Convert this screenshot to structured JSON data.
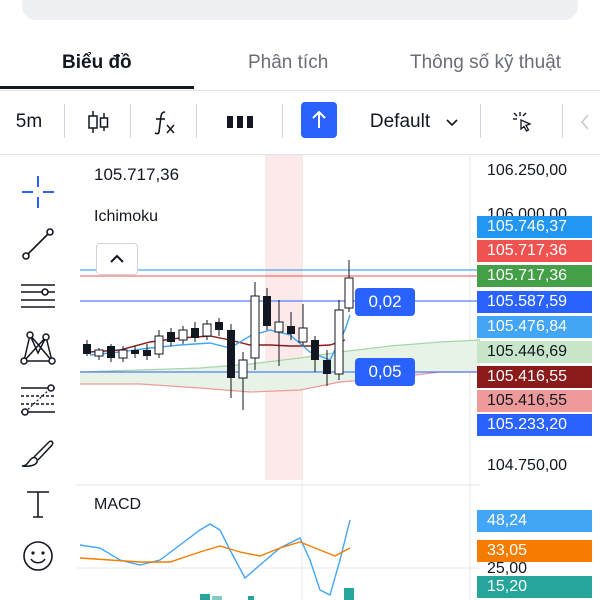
{
  "tabs": [
    {
      "label": "Biểu đồ",
      "active": true
    },
    {
      "label": "Phân tích",
      "active": false
    },
    {
      "label": "Thông số kỹ thuật",
      "active": false
    }
  ],
  "toolbar": {
    "interval": "5m",
    "style_label": "Default"
  },
  "chart": {
    "ohlc_label": "105.717,36",
    "indicator_label": "Ichimoku",
    "sub_indicator_label": "MACD"
  },
  "price_axis": {
    "top_label": "106.250,00",
    "bottom_label": "104.750,00",
    "hidden_label": "106.000,00"
  },
  "price_tags": [
    {
      "value": "105.746,37",
      "color": "#2196f3"
    },
    {
      "value": "105.717,36",
      "color": "#ef5350"
    },
    {
      "value": "105.717,36",
      "color": "#43a047"
    },
    {
      "value": "105.587,59",
      "color": "#2962ff"
    },
    {
      "value": "105.476,84",
      "color": "#42a5f5"
    },
    {
      "value": "105.446,69",
      "color": "#c8e6c9"
    },
    {
      "value": "105.416,55",
      "color": "#8b1a1a"
    },
    {
      "value": "105.416,55",
      "color": "#ef9a9a"
    },
    {
      "value": "105.233,20",
      "color": "#2962ff"
    }
  ],
  "pills": {
    "upper": "0,02",
    "lower": "0,05"
  },
  "macd_tags": [
    {
      "value": "48,24",
      "color": "#42a5f5"
    },
    {
      "value": "33,05",
      "color": "#f57c00"
    },
    {
      "value": "25,00",
      "color": "#131722"
    },
    {
      "value": "15,20",
      "color": "#26a69a"
    }
  ],
  "icons": {
    "toolbar": [
      "candles-icon",
      "function-icon",
      "bars-icon",
      "arrow-up-icon",
      "chevron-down-icon",
      "cursor-icon"
    ],
    "left": [
      "crosshair-icon",
      "trendline-icon",
      "horizontal-lines-icon",
      "pattern-icon",
      "fib-icon",
      "brush-icon",
      "text-icon",
      "emoji-icon"
    ]
  }
}
